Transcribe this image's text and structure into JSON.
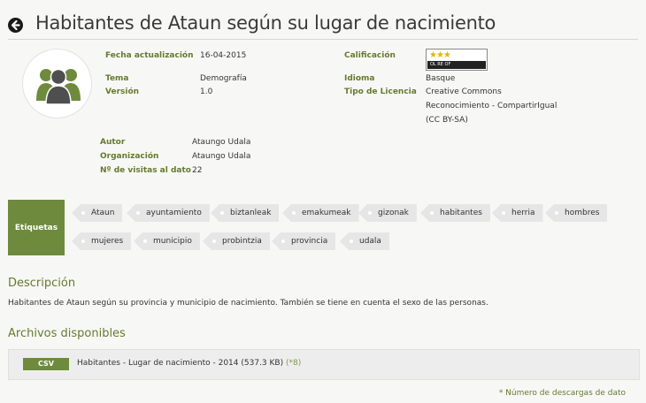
{
  "page": {
    "title": "Habitantes de Ataun según su lugar de nacimiento"
  },
  "icons": {
    "back": "arrow-left-circle-icon",
    "avatar": "people-group-icon"
  },
  "colors": {
    "accent": "#6e8b3d",
    "label": "#667a2e",
    "tag_bg": "#e6e6e6"
  },
  "meta_left": {
    "updated": {
      "label": "Fecha actualización",
      "value": "16-04-2015"
    },
    "topic": {
      "label": "Tema",
      "value": "Demografía"
    },
    "version": {
      "label": "Versión",
      "value": "1.0"
    }
  },
  "meta_right": {
    "rating": {
      "label": "Calificación",
      "stars": "★★★",
      "bar_text": "OL  RE  OF",
      "level": 3
    },
    "language": {
      "label": "Idioma",
      "value": "Basque"
    },
    "license": {
      "label": "Tipo de Licencia",
      "lines": [
        "Creative Commons",
        "Reconocimiento - CompartirIgual",
        "(CC BY-SA)"
      ]
    }
  },
  "meta_bottom": {
    "author": {
      "label": "Autor",
      "value": "Ataungo Udala"
    },
    "organization": {
      "label": "Organización",
      "value": "Ataungo Udala"
    },
    "visits": {
      "label": "Nº de visitas al dato",
      "value": "22"
    }
  },
  "tags": {
    "heading": "Etiquetas",
    "items": [
      "Ataun",
      "ayuntamiento",
      "biztanleak",
      "emakumeak",
      "gizonak",
      "habitantes",
      "herria",
      "hombres",
      "mujeres",
      "municipio",
      "probintzia",
      "provincia",
      "udala"
    ]
  },
  "description": {
    "heading": "Descripción",
    "text": "Habitantes de Ataun según su provincia y municipio de nacimiento. También se tiene en cuenta el sexo de las personas."
  },
  "files": {
    "heading": "Archivos disponibles",
    "items": [
      {
        "format": "CSV",
        "name": "Habitantes - Lugar de nacimiento - 2014 (537.3 KB)",
        "downloads": "(*8)"
      }
    ]
  },
  "footnote": "* Número de descargas de dato"
}
